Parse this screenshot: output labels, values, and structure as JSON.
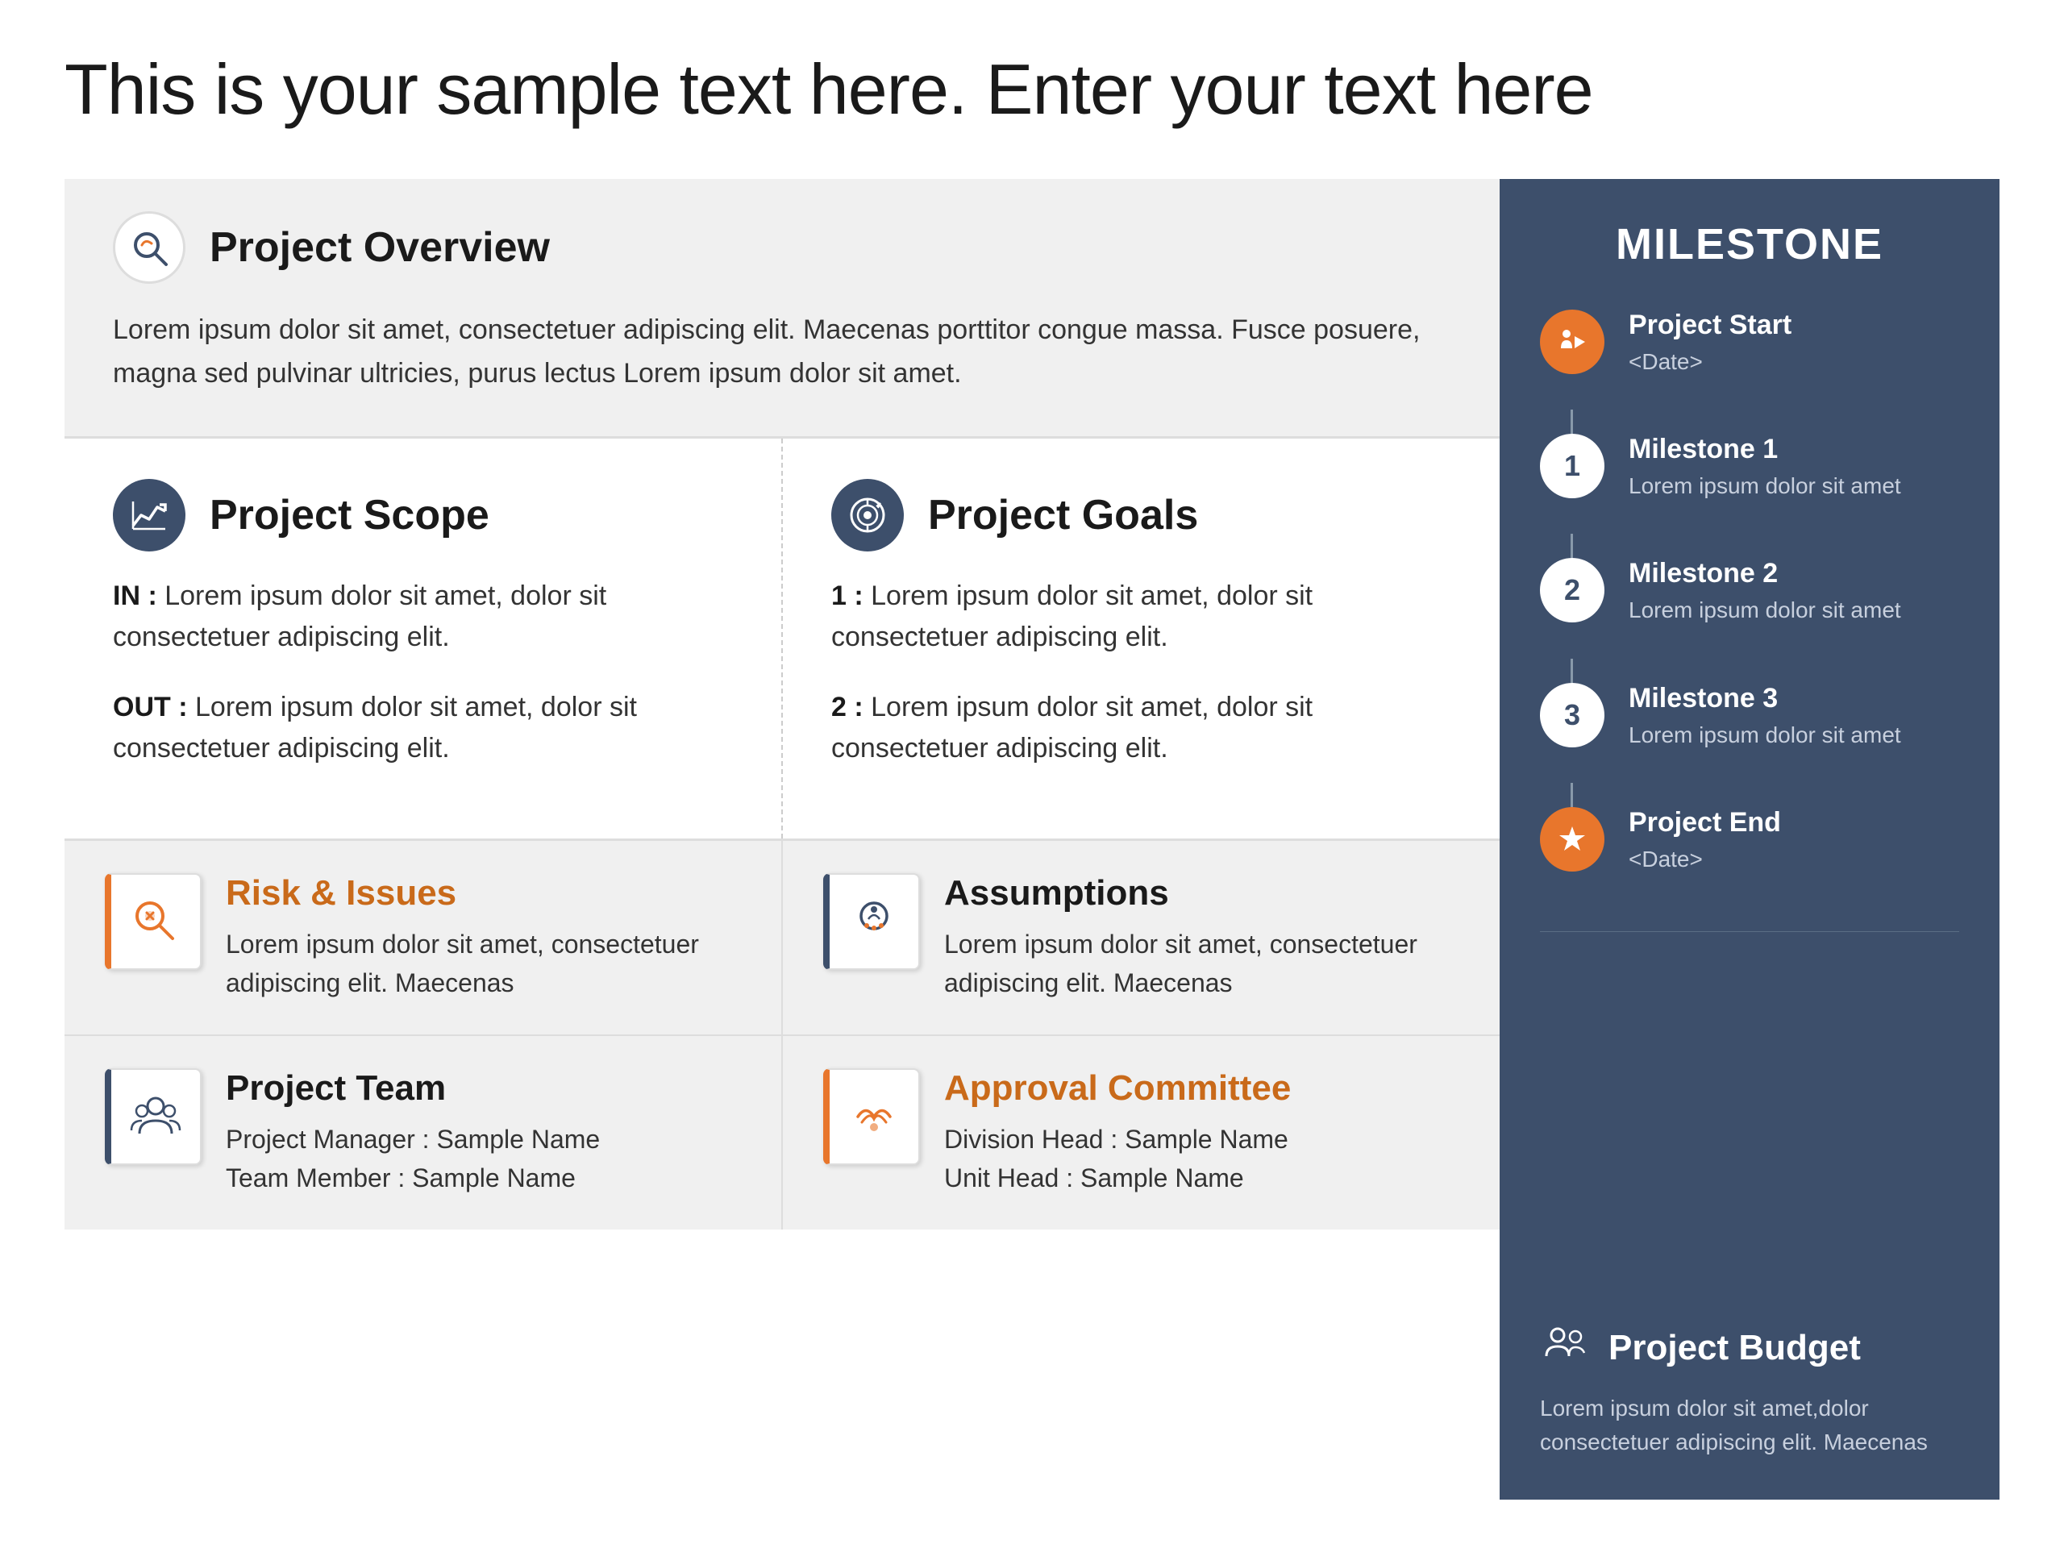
{
  "page": {
    "main_title": "This is your sample text here. Enter your text here"
  },
  "project_overview": {
    "title": "Project Overview",
    "icon": "🔍",
    "body": "Lorem ipsum dolor sit amet, consectetuer adipiscing elit. Maecenas porttitor congue massa. Fusce posuere, magna sed pulvinar ultricies, purus lectus Lorem ipsum dolor sit amet."
  },
  "project_scope": {
    "title": "Project Scope",
    "icon": "📈",
    "items": [
      {
        "label": "IN :",
        "text": "Lorem ipsum dolor sit amet, dolor sit consectetuer adipiscing elit."
      },
      {
        "label": "OUT :",
        "text": "Lorem ipsum dolor sit amet, dolor sit consectetuer adipiscing elit."
      }
    ]
  },
  "project_goals": {
    "title": "Project Goals",
    "icon": "🎯",
    "items": [
      {
        "label": "1 :",
        "text": "Lorem ipsum dolor sit amet, dolor sit consectetuer adipiscing elit."
      },
      {
        "label": "2 :",
        "text": "Lorem ipsum dolor sit amet, dolor sit consectetuer adipiscing elit."
      }
    ]
  },
  "risk_issues": {
    "title": "Risk & Issues",
    "icon": "🔎",
    "body": "Lorem ipsum dolor sit amet, consectetuer adipiscing elit. Maecenas"
  },
  "assumptions": {
    "title": "Assumptions",
    "icon": "🧠",
    "body": "Lorem ipsum dolor sit amet, consectetuer adipiscing elit. Maecenas"
  },
  "project_team": {
    "title": "Project Team",
    "icon": "👥",
    "lines": [
      "Project Manager : Sample Name",
      "Team Member : Sample Name"
    ]
  },
  "approval_committee": {
    "title": "Approval Committee",
    "icon": "🤝",
    "lines": [
      "Division Head : Sample Name",
      "Unit Head : Sample Name"
    ]
  },
  "milestone": {
    "title": "MILESTONE",
    "items": [
      {
        "type": "orange",
        "icon": "🏃",
        "label": "Project Start",
        "body": "<Date>"
      },
      {
        "type": "white",
        "number": "1",
        "label": "Milestone 1",
        "body": "Lorem ipsum dolor sit amet"
      },
      {
        "type": "white",
        "number": "2",
        "label": "Milestone 2",
        "body": "Lorem ipsum dolor sit amet"
      },
      {
        "type": "white",
        "number": "3",
        "label": "Milestone 3",
        "body": "Lorem ipsum dolor sit amet"
      },
      {
        "type": "orange",
        "icon": "⭐",
        "label": "Project End",
        "body": "<Date>"
      }
    ]
  },
  "project_budget": {
    "title": "Project Budget",
    "icon": "👥",
    "body": "Lorem ipsum dolor sit amet,dolor consectetuer adipiscing elit. Maecenas"
  }
}
